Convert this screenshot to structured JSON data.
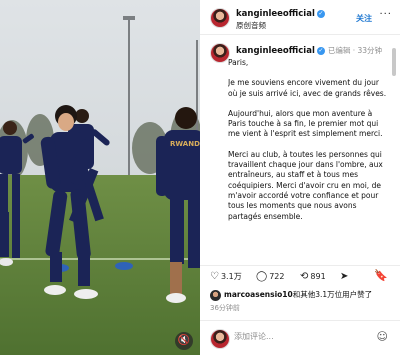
{
  "header": {
    "username": "kanginleeofficial",
    "subtitle": "原创音频",
    "follow_label": "关注",
    "more_label": "···"
  },
  "post": {
    "username": "kanginleeofficial",
    "edited_label": "已编辑 · 33分钟",
    "paragraphs": [
      "Paris,",
      "Je me souviens encore vivement du jour où je suis arrivé ici, avec de grands rêves.",
      "Aujourd'hui, alors que mon aventure à Paris touche à sa fin, le premier mot qui me vient à l'esprit est simplement merci.",
      "Merci au club, à toutes les personnes qui travaillent chaque jour dans l'ombre, aux entraîneurs, au staff et à tous mes coéquipiers. Merci d'avoir cru en moi, de m'avoir accordé votre confiance et pour tous les moments que nous avons partagés ensemble."
    ]
  },
  "actions": {
    "likes_count": "3.1万",
    "comments_count": "722",
    "shares_count": "891"
  },
  "likes_line": {
    "user": "marcoasensio10",
    "rest": "和其他3.1万位用户赞了"
  },
  "timestamp": "36分钟前",
  "comment": {
    "placeholder": "添加评论..."
  },
  "media": {
    "jersey_text": "RWANDA"
  },
  "icons": {
    "verified": "verified-icon",
    "heart": "heart-icon",
    "comment": "comment-icon",
    "repost": "repost-icon",
    "share": "share-icon",
    "bookmark": "bookmark-icon",
    "emoji": "emoji-icon",
    "mute": "mute-icon"
  },
  "colors": {
    "accent": "#1f78d1",
    "verified": "#3897f0",
    "kit": "#1b2456"
  }
}
